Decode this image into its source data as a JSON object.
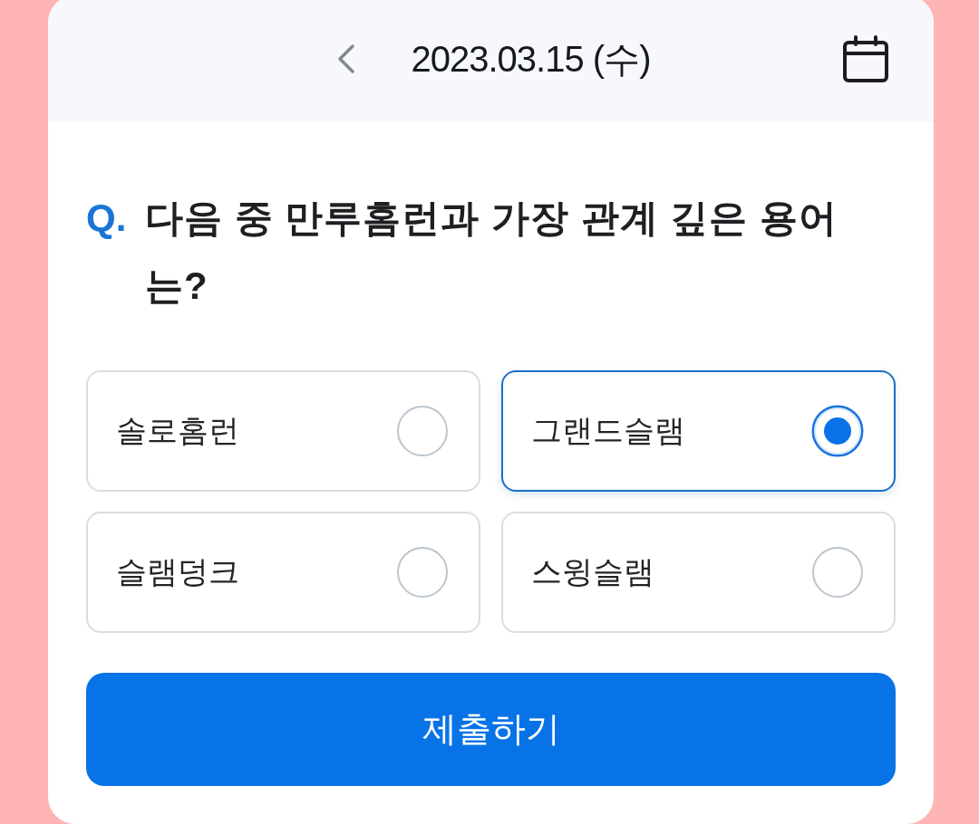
{
  "header": {
    "date": "2023.03.15 (수)"
  },
  "question": {
    "marker": "Q.",
    "text": "다음 중 만루홈런과 가장 관계 깊은 용어는?"
  },
  "options": [
    {
      "label": "솔로홈런",
      "selected": false
    },
    {
      "label": "그랜드슬램",
      "selected": true
    },
    {
      "label": "슬램덩크",
      "selected": false
    },
    {
      "label": "스윙슬램",
      "selected": false
    }
  ],
  "submit_button": {
    "label": "제출하기"
  }
}
